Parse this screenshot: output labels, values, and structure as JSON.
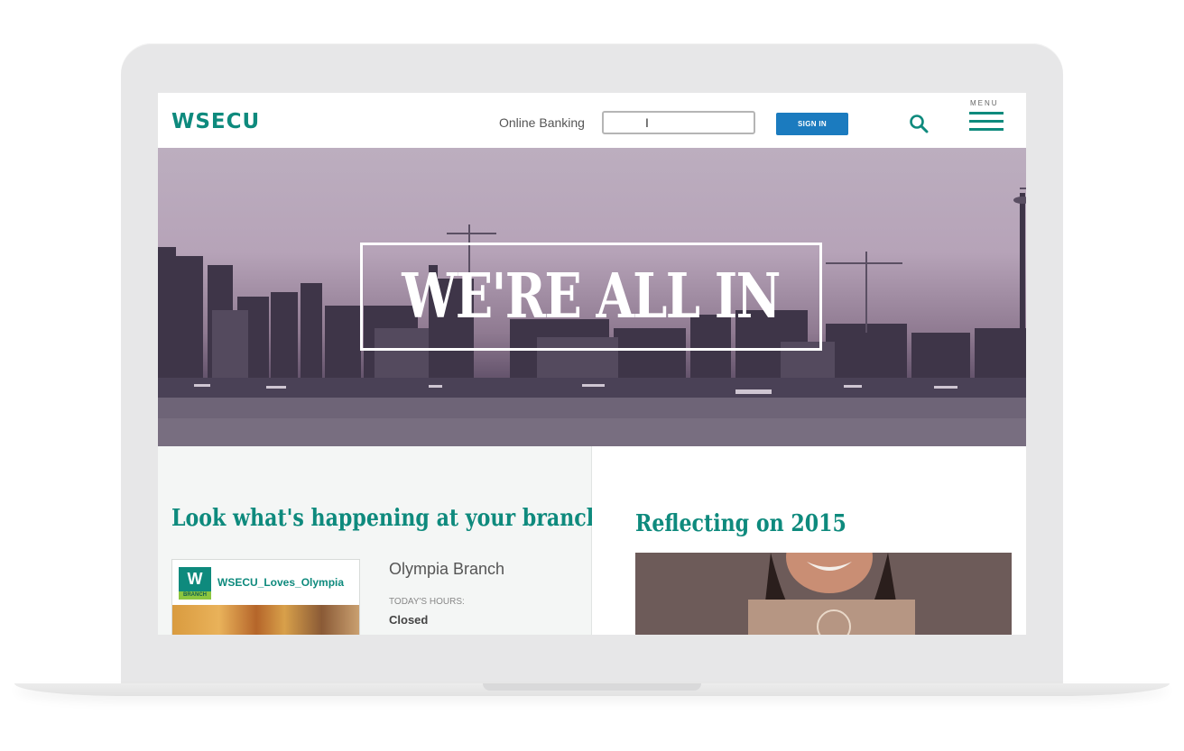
{
  "header": {
    "logo": "WSECU",
    "online_banking_label": "Online Banking",
    "login_input_value": "I",
    "sign_in_label": "SIGN IN",
    "menu_label": "MENU"
  },
  "hero": {
    "title": "WE'RE ALL IN"
  },
  "branch_section": {
    "heading": "Look what's happening at your branch",
    "instagram_account": "WSECU_Loves_Olympia",
    "badge_letter": "W",
    "badge_text": "BRANCH",
    "branch_name": "Olympia Branch",
    "hours_label": "TODAY'S HOURS:",
    "hours_value": "Closed"
  },
  "news_section": {
    "heading": "Reflecting on 2015"
  },
  "colors": {
    "brand": "#0e8a7d",
    "button": "#1b7bbf",
    "badge_green": "#8cc63f"
  },
  "icons": [
    "search-icon",
    "menu-icon"
  ]
}
